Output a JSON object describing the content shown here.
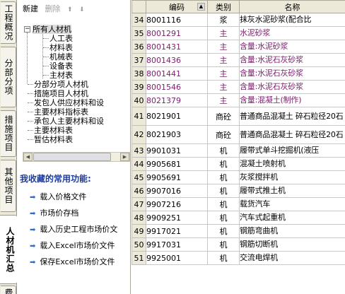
{
  "vertical_tabs": [
    {
      "label": "工程概况",
      "active": false
    },
    {
      "label": "分部分项",
      "active": false
    },
    {
      "label": "措施项目",
      "active": false
    },
    {
      "label": "其他项目",
      "active": false
    },
    {
      "label": "人材机汇总",
      "active": true
    },
    {
      "label": "费",
      "active": false
    }
  ],
  "toolbar": {
    "new_label": "新建",
    "delete_label": "删除",
    "up_icon": "up-arrow-icon",
    "down_icon": "down-arrow-icon"
  },
  "tree": {
    "root": "所有人材机",
    "children": [
      "人工表",
      "材料表",
      "机械表",
      "设备表",
      "主材表"
    ],
    "others": [
      "分部分项人材机",
      "措施项目人材机",
      "发包人供应材料和设",
      "主要材料指标表",
      "承包人主要材料和设",
      "主要材料表",
      "暂估材料表"
    ]
  },
  "favorites": {
    "title": "我收藏的常用功能:",
    "items": [
      "载入价格文件",
      "市场价存档",
      "载入历史工程市场价文",
      "载入Excel市场价文件",
      "保存Excel市场价文件"
    ]
  },
  "grid": {
    "headers": [
      "编码",
      "类别",
      "名称"
    ],
    "rows": [
      {
        "no": "34",
        "code": "8001116",
        "cls": "浆",
        "name": "抹灰水泥砂浆(配合比",
        "highlight": false
      },
      {
        "no": "35",
        "code": "8001291",
        "cls": "主",
        "name": "水泥砂浆",
        "highlight": true
      },
      {
        "no": "36",
        "code": "8001431",
        "cls": "主",
        "name": "含量:水泥砂浆",
        "highlight": true
      },
      {
        "no": "37",
        "code": "8001436",
        "cls": "主",
        "name": "含量:水泥石灰砂浆",
        "highlight": true
      },
      {
        "no": "38",
        "code": "8001441",
        "cls": "主",
        "name": "含量:水泥石灰砂浆",
        "highlight": true
      },
      {
        "no": "39",
        "code": "8001546",
        "cls": "主",
        "name": "含量:水泥石灰砂浆",
        "highlight": true
      },
      {
        "no": "40",
        "code": "8021379",
        "cls": "主",
        "name": "含量:混凝土(制作)",
        "highlight": true
      },
      {
        "no": "41",
        "code": "8021901",
        "cls": "商砼",
        "name": "普通商品混凝土 碎石粒径20石",
        "highlight": false
      },
      {
        "no": "42",
        "code": "8021903",
        "cls": "商砼",
        "name": "普通商品混凝土 碎石粒径20石",
        "highlight": false
      },
      {
        "no": "43",
        "code": "9901031",
        "cls": "机",
        "name": "履带式单斗挖掘机(液压",
        "highlight": false
      },
      {
        "no": "44",
        "code": "9905681",
        "cls": "机",
        "name": "混凝土喷射机",
        "highlight": false
      },
      {
        "no": "45",
        "code": "9905691",
        "cls": "机",
        "name": "灰浆搅拌机",
        "highlight": false
      },
      {
        "no": "46",
        "code": "9907016",
        "cls": "机",
        "name": "履带式推土机",
        "highlight": false
      },
      {
        "no": "47",
        "code": "9907216",
        "cls": "机",
        "name": "载货汽车",
        "highlight": false
      },
      {
        "no": "48",
        "code": "9909251",
        "cls": "机",
        "name": "汽车式起重机",
        "highlight": false
      },
      {
        "no": "49",
        "code": "9917021",
        "cls": "机",
        "name": "钢筋弯曲机",
        "highlight": false
      },
      {
        "no": "50",
        "code": "9917031",
        "cls": "机",
        "name": "钢筋切断机",
        "highlight": false
      },
      {
        "no": "51",
        "code": "9925001",
        "cls": "机",
        "name": "交流电焊机",
        "highlight": false
      }
    ]
  }
}
